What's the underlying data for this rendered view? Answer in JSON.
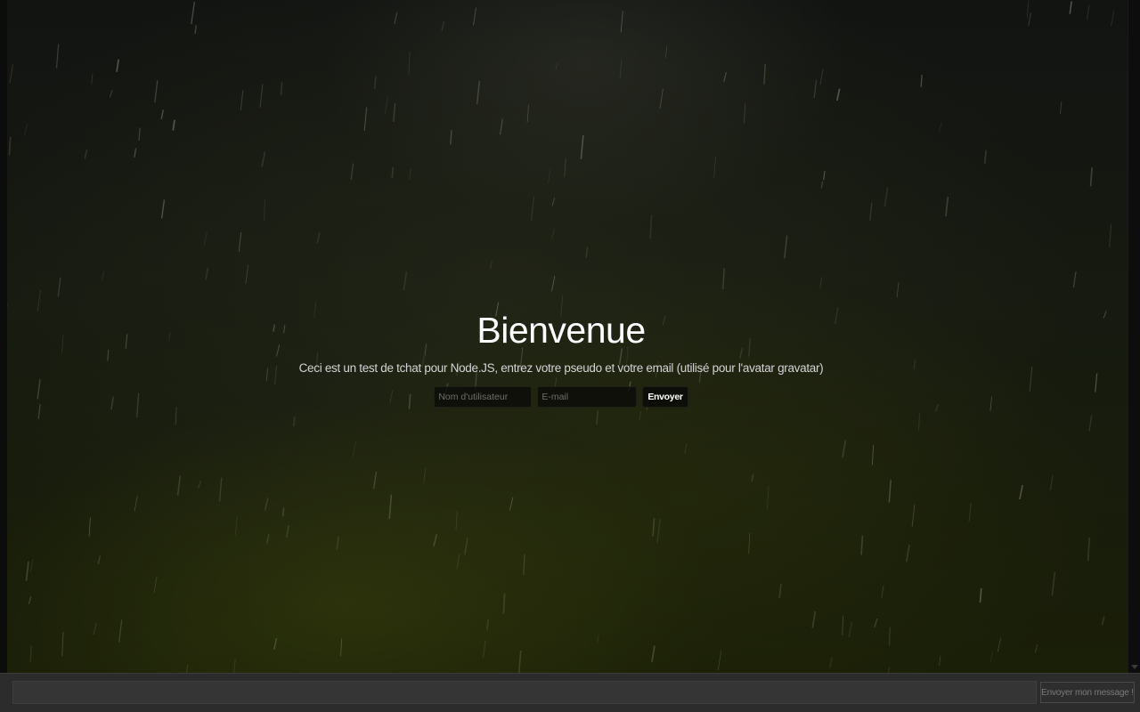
{
  "welcome": {
    "title": "Bienvenue",
    "description": "Ceci est un test de tchat pour Node.JS, entrez votre pseudo et votre email (utilisé pour l'avatar gravatar)",
    "username_placeholder": "Nom d'utilisateur",
    "email_placeholder": "E-mail",
    "submit_label": "Envoyer"
  },
  "footer": {
    "message_value": "",
    "send_label": "Envoyer mon message !"
  },
  "colors": {
    "title_text": "#ffffff",
    "description_text": "#d4d4d4",
    "footer_bg": "#2c2c2c"
  }
}
